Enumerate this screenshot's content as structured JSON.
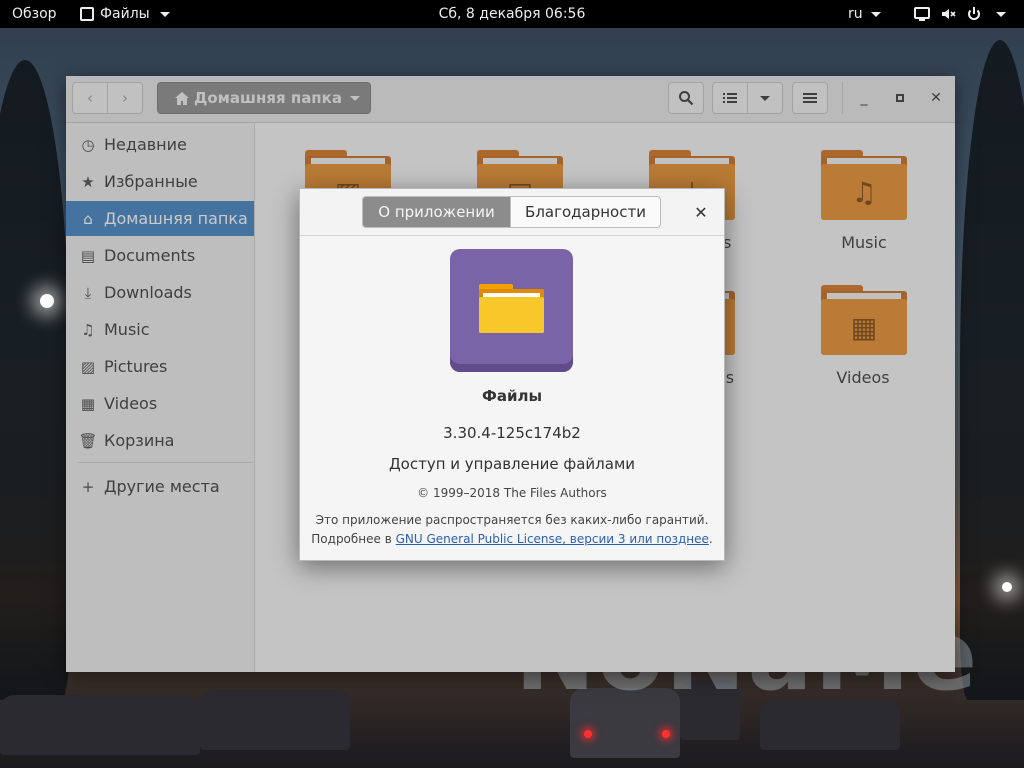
{
  "topbar": {
    "overview": "Обзор",
    "app_name": "Файлы",
    "clock": "Сб, 8 декабря  06:56",
    "lang": "ru"
  },
  "files_window": {
    "path_label": "Домашняя папка",
    "sidebar": {
      "items": [
        {
          "label": "Недавние",
          "icon": "clock-icon"
        },
        {
          "label": "Избранные",
          "icon": "star-icon"
        },
        {
          "label": "Домашняя папка",
          "icon": "home-icon",
          "active": true
        },
        {
          "label": "Documents",
          "icon": "document-icon"
        },
        {
          "label": "Downloads",
          "icon": "download-icon"
        },
        {
          "label": "Music",
          "icon": "music-icon"
        },
        {
          "label": "Pictures",
          "icon": "image-icon"
        },
        {
          "label": "Videos",
          "icon": "film-icon"
        },
        {
          "label": "Корзина",
          "icon": "trash-icon"
        }
      ],
      "other_places": "Другие места"
    },
    "folders": [
      {
        "label": "",
        "icon": "image-icon"
      },
      {
        "label": "",
        "icon": "document-icon"
      },
      {
        "label": "ls",
        "icon": "download-icon"
      },
      {
        "label": "Music",
        "icon": "music-icon"
      },
      {
        "label": "",
        "icon": "folder-icon"
      },
      {
        "label": "es",
        "icon": "folder-icon"
      },
      {
        "label": "Videos",
        "icon": "film-icon"
      }
    ]
  },
  "about_dialog": {
    "tab_about": "О приложении",
    "tab_credits": "Благодарности",
    "app_name": "Файлы",
    "version": "3.30.4-125c174b2",
    "description": "Доступ и управление файлами",
    "copyright": "© 1999–2018 The Files Authors",
    "license_line1": "Это приложение распространяется без каких-либо гарантий.",
    "license_prefix": "Подробнее в ",
    "license_link": "GNU General Public License, версии 3 или позднее",
    "license_suffix": "."
  },
  "colors": {
    "accent": "#3b7fc1",
    "folder_orange": "#e68b24",
    "app_icon_purple": "#7a64a8"
  }
}
